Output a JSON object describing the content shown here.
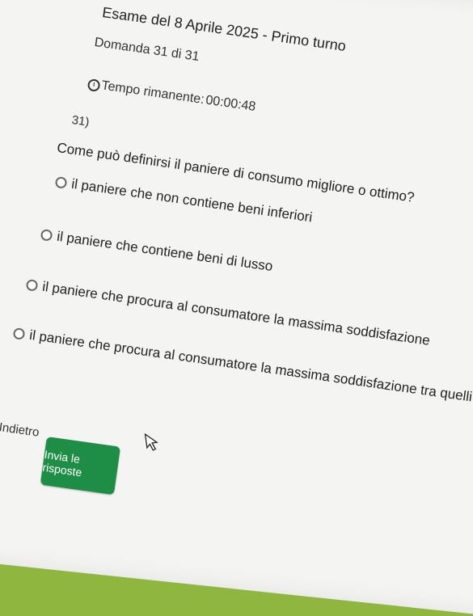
{
  "header": {
    "title": "Esame del 8 Aprile 2025 - Primo turno",
    "question_position": "Domanda 31 di 31",
    "timer_label": "Tempo rimanente:",
    "timer_value": "00:00:48"
  },
  "question": {
    "number": "31)",
    "text": "Come può definirsi il paniere di consumo migliore o ottimo?",
    "options": [
      "il paniere che non contiene beni inferiori",
      "il paniere che contiene beni di lusso",
      "il paniere che procura al consumatore la massima soddisfazione",
      "il paniere che procura al consumatore la massima soddisfazione tra quelli possibili"
    ]
  },
  "footer": {
    "back_label": "Indietro",
    "submit_label": "Invia le risposte"
  },
  "colors": {
    "background": "#8fb63e",
    "submit_button": "#1e8d45"
  },
  "icons": {
    "timer": "clock-icon",
    "cursor": "mouse-pointer-icon"
  }
}
